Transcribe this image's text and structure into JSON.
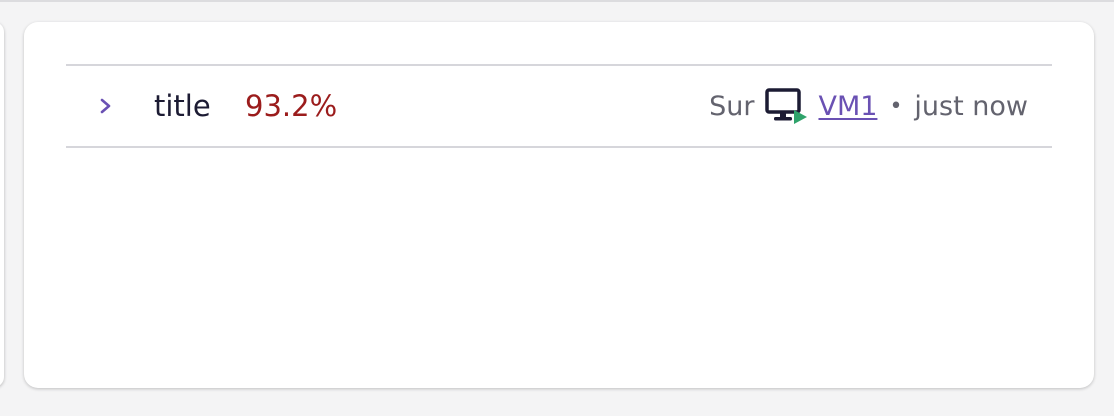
{
  "row": {
    "title": "title",
    "value": "93.2%",
    "prefix": "Sur",
    "vm_name": "VM1",
    "separator": "•",
    "timestamp": "just now"
  },
  "icons": {
    "expand": "chevron-right-icon",
    "vm": "monitor-play-icon"
  },
  "colors": {
    "value": "#9b1c1c",
    "link": "#6a51b3",
    "chevron": "#6a51b3",
    "play": "#2fa36b",
    "monitor": "#1c1b33"
  }
}
